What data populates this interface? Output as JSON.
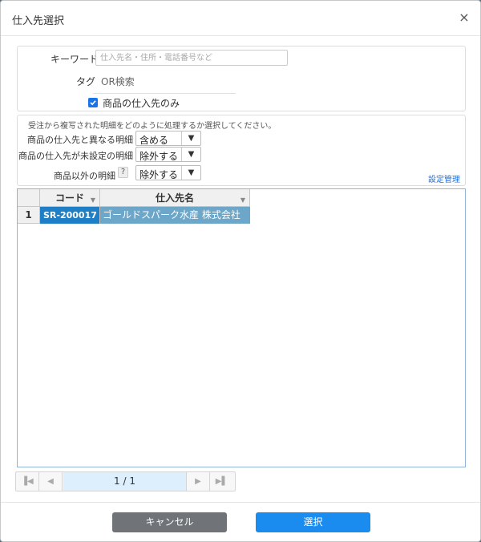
{
  "dialog": {
    "title": "仕入先選択",
    "close_label": "×"
  },
  "search": {
    "keyword_label": "キーワード",
    "keyword_placeholder": "仕入先名・住所・電話番号など",
    "keyword_value": "",
    "tag_label": "タグ",
    "tag_value": "OR検索",
    "product_suppliers_only_label": "商品の仕入先のみ",
    "product_suppliers_only_checked": true
  },
  "options": {
    "hint": "受注から複写された明細をどのように処理するか選択してください。",
    "rows": [
      {
        "label": "商品の仕入先と異なる明細",
        "value": "含める"
      },
      {
        "label": "商品の仕入先が未設定の明細",
        "value": "除外する"
      },
      {
        "label": "商品以外の明細",
        "value": "除外する"
      }
    ],
    "help_label": "?",
    "settings_link": "設定管理"
  },
  "grid": {
    "columns": [
      "コード",
      "仕入先名"
    ],
    "rows": [
      {
        "num": "1",
        "code": "SR-200017",
        "name": "ゴールドスパーク水産 株式会社"
      }
    ]
  },
  "pager": {
    "info": "1 / 1"
  },
  "buttons": {
    "cancel": "キャンセル",
    "select": "選択"
  },
  "colors": {
    "accent": "#1a8cf0",
    "selected_code": "#1f7fc6",
    "selected_name": "#6ca6c9",
    "cancel": "#707478"
  }
}
